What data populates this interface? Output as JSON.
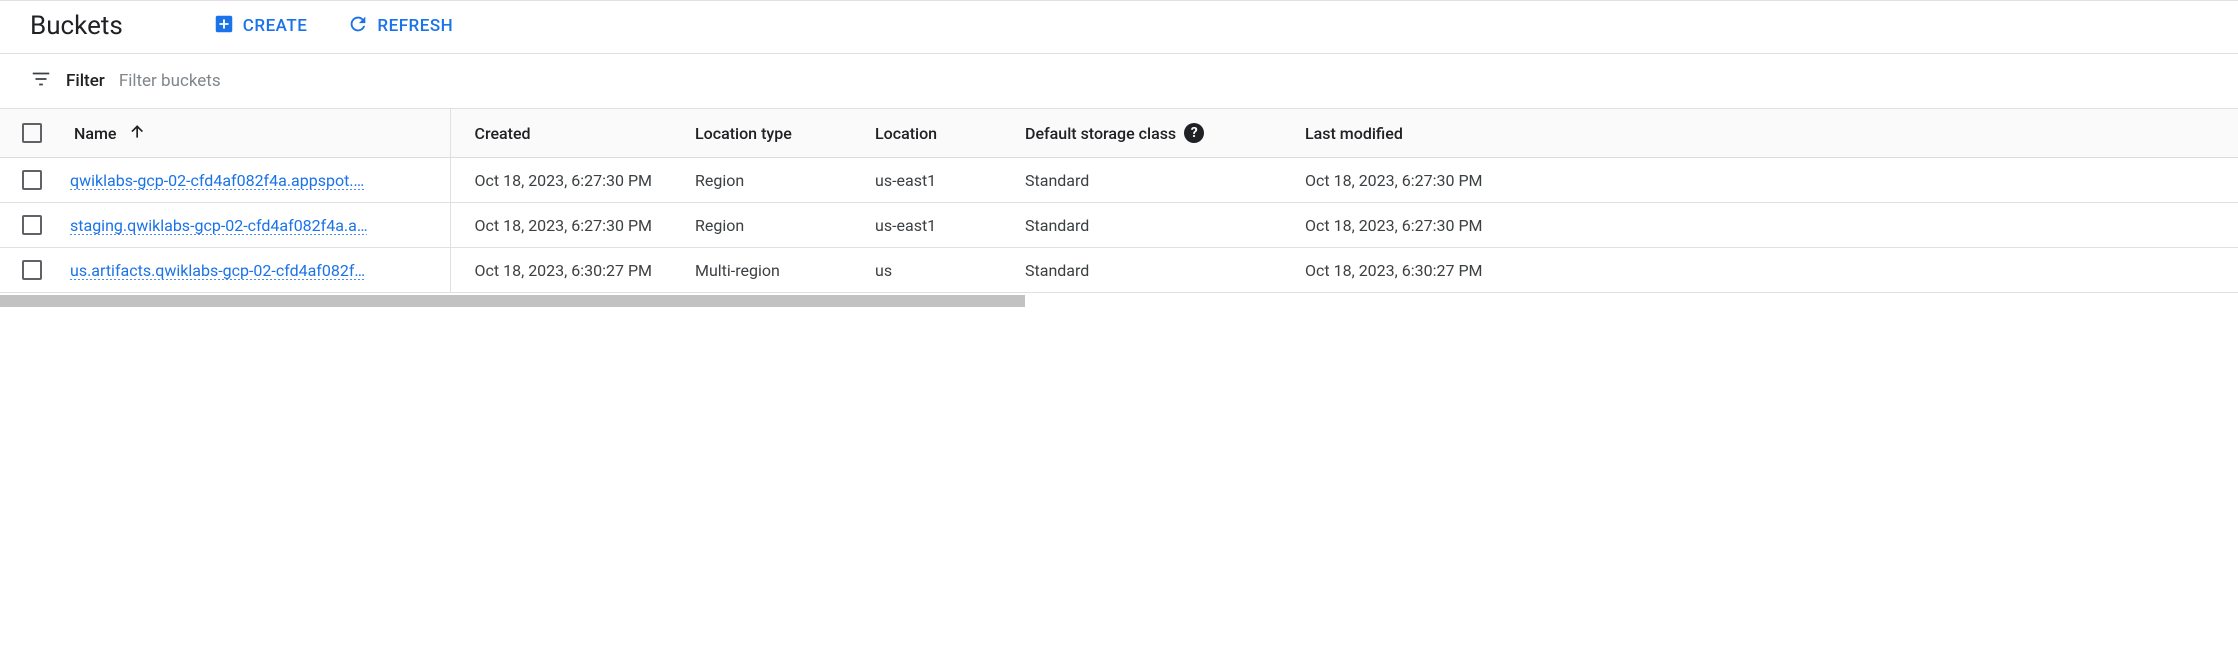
{
  "header": {
    "title": "Buckets",
    "create_label": "CREATE",
    "refresh_label": "REFRESH"
  },
  "filter": {
    "label": "Filter",
    "placeholder": "Filter buckets"
  },
  "columns": {
    "name": "Name",
    "created": "Created",
    "location_type": "Location type",
    "location": "Location",
    "storage_class": "Default storage class",
    "last_modified": "Last modified"
  },
  "rows": [
    {
      "name": "qwiklabs-gcp-02-cfd4af082f4a.appspot.…",
      "created": "Oct 18, 2023, 6:27:30 PM",
      "location_type": "Region",
      "location": "us-east1",
      "storage_class": "Standard",
      "last_modified": "Oct 18, 2023, 6:27:30 PM"
    },
    {
      "name": "staging.qwiklabs-gcp-02-cfd4af082f4a.a…",
      "created": "Oct 18, 2023, 6:27:30 PM",
      "location_type": "Region",
      "location": "us-east1",
      "storage_class": "Standard",
      "last_modified": "Oct 18, 2023, 6:27:30 PM"
    },
    {
      "name": "us.artifacts.qwiklabs-gcp-02-cfd4af082f…",
      "created": "Oct 18, 2023, 6:30:27 PM",
      "location_type": "Multi-region",
      "location": "us",
      "storage_class": "Standard",
      "last_modified": "Oct 18, 2023, 6:30:27 PM"
    }
  ]
}
